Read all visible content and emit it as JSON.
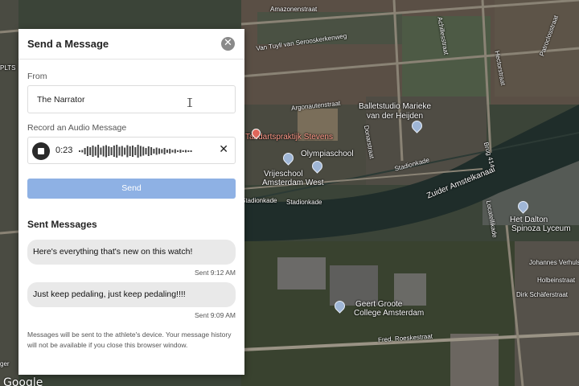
{
  "panel": {
    "title": "Send a Message",
    "from_label": "From",
    "from_value": "The Narrator",
    "record_label": "Record an Audio Message",
    "audio_time": "0:23",
    "send_label": "Send",
    "sent_title": "Sent Messages",
    "messages": [
      {
        "text": "Here's everything that's new on this watch!",
        "time": "Sent 9:12 AM"
      },
      {
        "text": "Just keep pedaling, just keep pedaling!!!!",
        "time": "Sent 9:09 AM"
      }
    ],
    "footnote": "Messages will be sent to the athlete's device. Your message history will not be available if you close this browser window."
  },
  "icons": {
    "close": "close-icon",
    "stop": "stop-icon",
    "clear": "clear-icon"
  },
  "colors": {
    "send_button": "#8eb1e4",
    "bubble": "#e9e9e9"
  },
  "map": {
    "labels": {
      "amazonenstraat": "Amazonenstraat",
      "seroos": "Van Tuyll van Serooskerkenweg",
      "argonauten": "Argonautenstraat",
      "ballet1": "Balletstudio Marieke",
      "ballet2": "van der Heijden",
      "tandarts": "Tandartspraktijk Stevens",
      "olympia": "Olympiaschool",
      "vrij1": "Vrijeschool",
      "vrij2": "Amsterdam West",
      "stadion1": "Stadionkade",
      "stadion2": "Stadionkade",
      "zuider": "Zuider Amstelkanaal",
      "dalton1": "Het Dalton",
      "dalton2": "Spinoza Lyceum",
      "johannes": "Johannes Verhulstr",
      "holbein": "Holbeinstraat",
      "dirk": "Dirk Schäferstraat",
      "geert1": "Geert Groote",
      "geert2": "College Amsterdam",
      "fred": "Fred. Roeskestraat",
      "achilles": "Achillesstraat",
      "hector": "Hectorstraat",
      "patroclos": "Patroclosstraat",
      "dona": "Donarstraat",
      "locatelli": "Locatellikade",
      "brug": "Brug 414",
      "left1": "PLTS",
      "left2": "ger",
      "google": "Google"
    }
  }
}
